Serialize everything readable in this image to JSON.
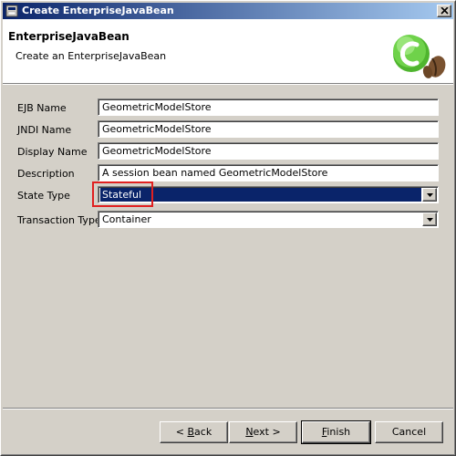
{
  "window": {
    "title": "Create EnterpriseJavaBean"
  },
  "header": {
    "title": "EnterpriseJavaBean",
    "subtitle": "Create an EnterpriseJavaBean",
    "icon": "wizard-bean-icon"
  },
  "form": {
    "ejb_name": {
      "label": "EJB Name",
      "value": "GeometricModelStore"
    },
    "jndi_name": {
      "label": "JNDI Name",
      "value": "GeometricModelStore"
    },
    "display_name": {
      "label": "Display Name",
      "value": "GeometricModelStore"
    },
    "description": {
      "label": "Description",
      "value": "A session bean named GeometricModelStore"
    },
    "state_type": {
      "label": "State Type",
      "value": "Stateful"
    },
    "transaction_type": {
      "label": "Transaction Type",
      "value": "Container"
    }
  },
  "buttons": {
    "back_mnemonic": "B",
    "back_rest": "ack",
    "back_prefix": "< ",
    "next_mnemonic": "N",
    "next_rest": "ext >",
    "finish_mnemonic": "F",
    "finish_rest": "inish",
    "cancel": "Cancel"
  },
  "colors": {
    "title_gradient_start": "#0a246a",
    "title_gradient_end": "#a6caf0",
    "selection": "#0a246a",
    "highlight_box": "#e02020",
    "icon_green": "#5cc53c"
  }
}
